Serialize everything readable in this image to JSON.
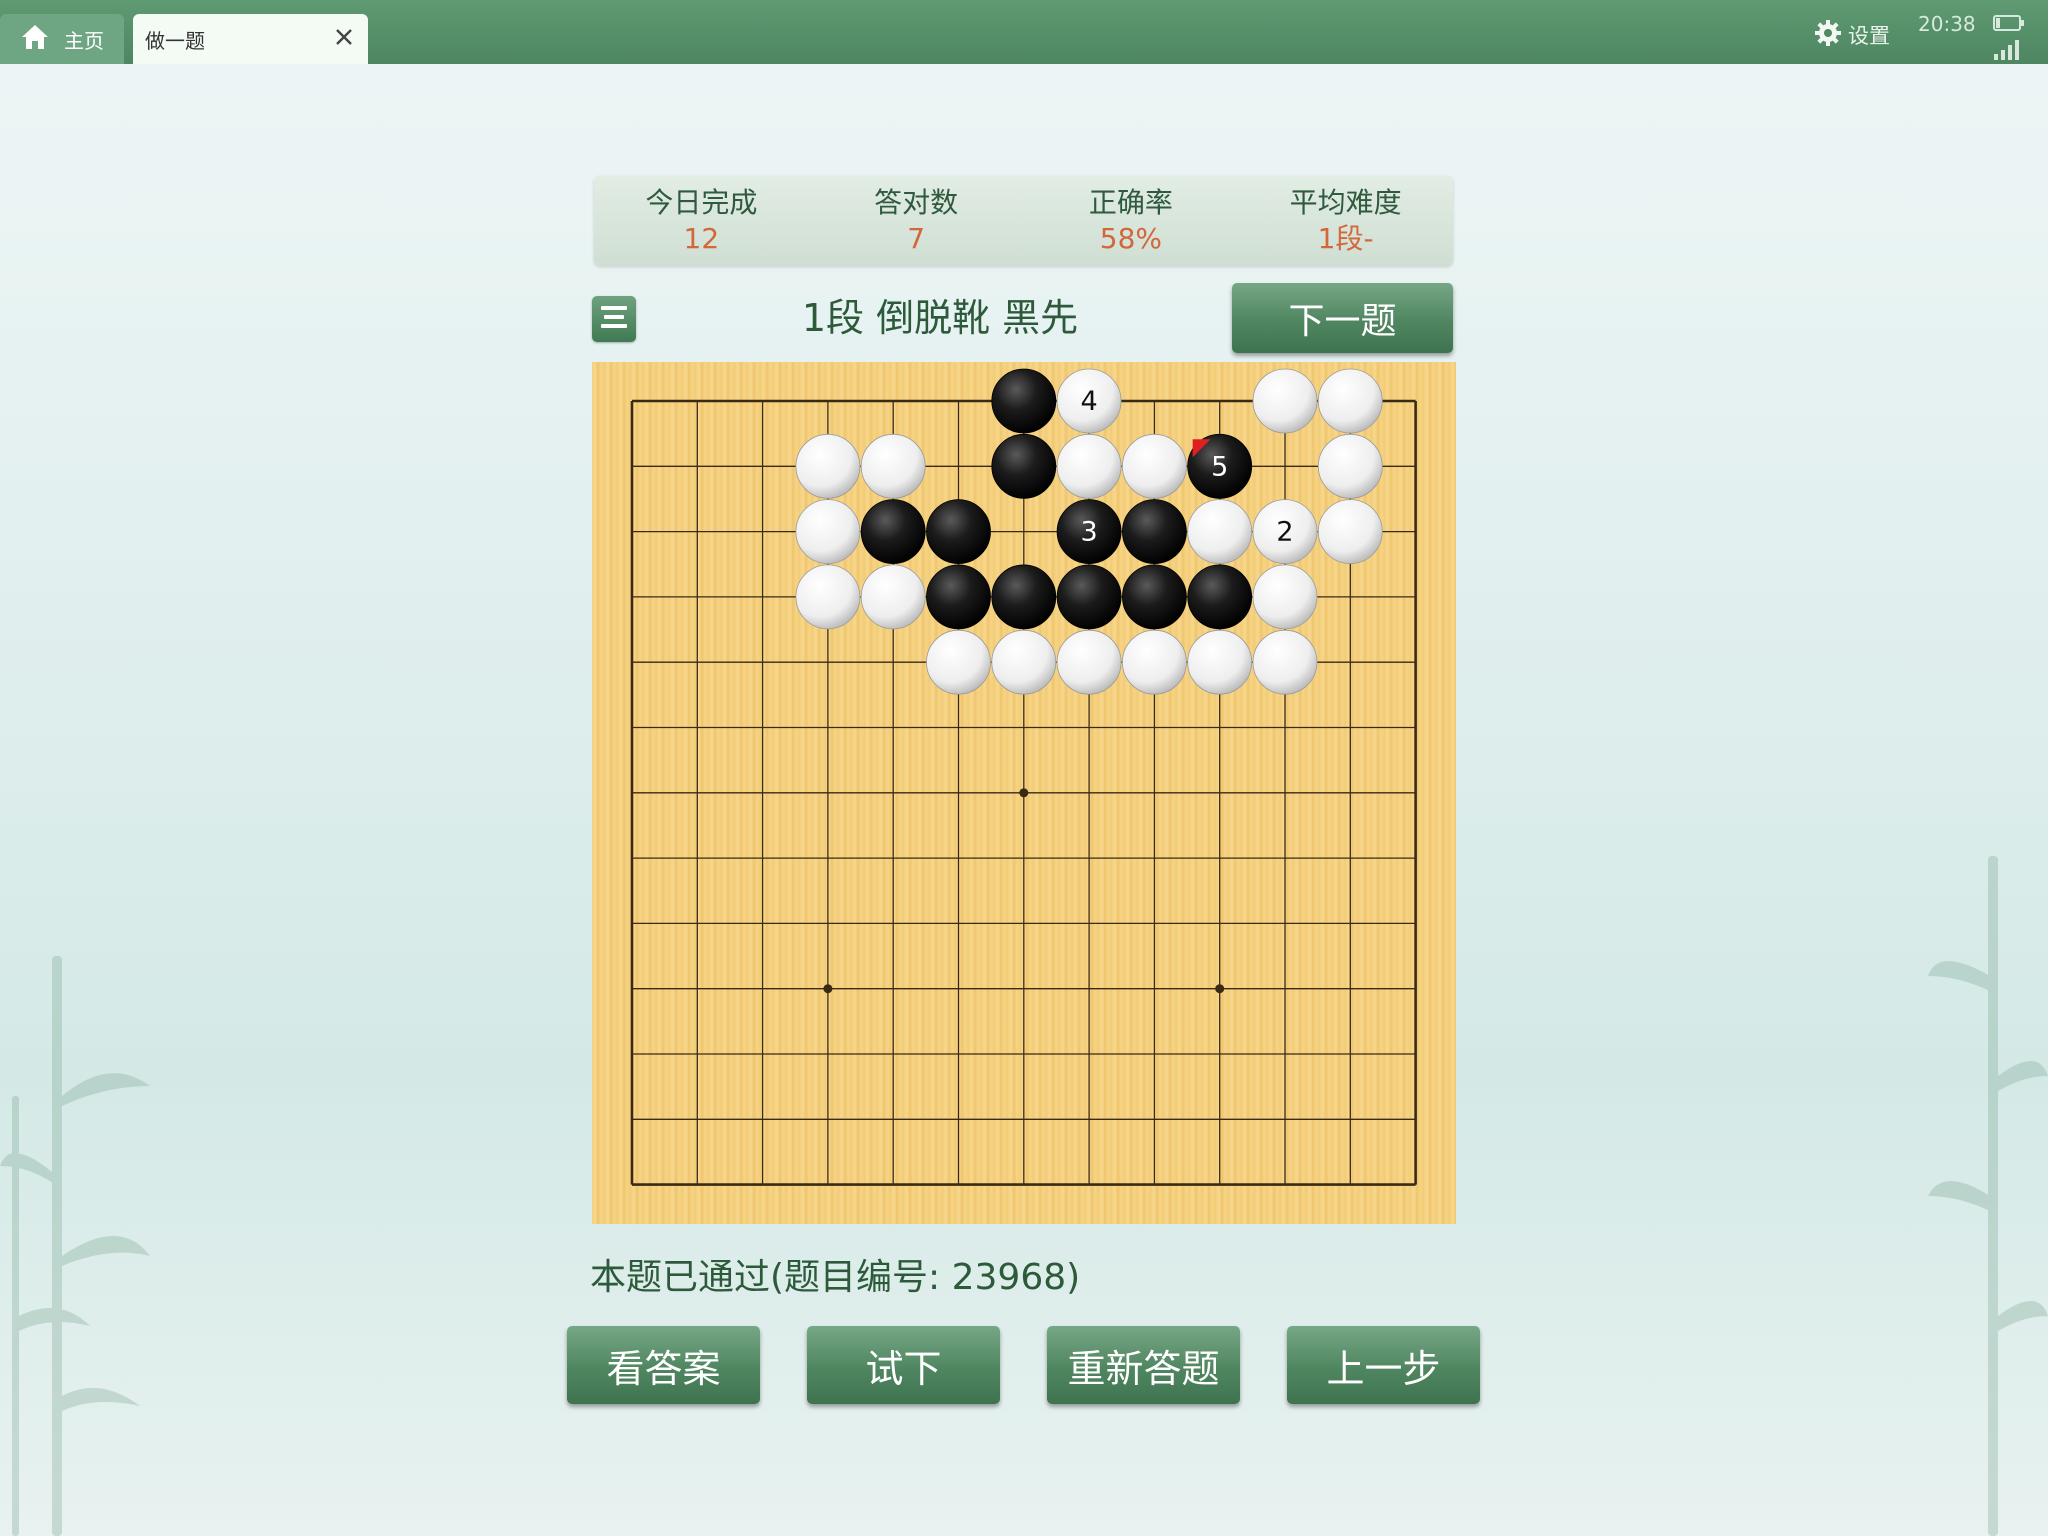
{
  "topbar": {
    "home_tab_label": "主页",
    "active_tab_label": "做一题",
    "settings_label": "设置",
    "time": "20:38"
  },
  "stats": [
    {
      "label": "今日完成",
      "value": "12"
    },
    {
      "label": "答对数",
      "value": "7"
    },
    {
      "label": "正确率",
      "value": "58%"
    },
    {
      "label": "平均难度",
      "value": "1段-"
    }
  ],
  "problem": {
    "title": "1段 倒脱靴 黑先",
    "next_label": "下一题",
    "status": "本题已通过(题目编号: 23968)"
  },
  "board": {
    "size": 13,
    "hoshi": [
      [
        6,
        6
      ],
      [
        3,
        9
      ],
      [
        9,
        9
      ]
    ],
    "stones": [
      {
        "color": "black",
        "x": 6,
        "y": 0
      },
      {
        "color": "white",
        "x": 7,
        "y": 0,
        "label": "4"
      },
      {
        "color": "white",
        "x": 10,
        "y": 0
      },
      {
        "color": "white",
        "x": 11,
        "y": 0
      },
      {
        "color": "white",
        "x": 3,
        "y": 1
      },
      {
        "color": "white",
        "x": 4,
        "y": 1
      },
      {
        "color": "black",
        "x": 6,
        "y": 1
      },
      {
        "color": "white",
        "x": 7,
        "y": 1
      },
      {
        "color": "white",
        "x": 8,
        "y": 1
      },
      {
        "color": "black",
        "x": 9,
        "y": 1,
        "label": "5"
      },
      {
        "color": "white",
        "x": 11,
        "y": 1
      },
      {
        "color": "white",
        "x": 3,
        "y": 2
      },
      {
        "color": "black",
        "x": 4,
        "y": 2
      },
      {
        "color": "black",
        "x": 5,
        "y": 2
      },
      {
        "color": "black",
        "x": 7,
        "y": 2,
        "label": "3"
      },
      {
        "color": "black",
        "x": 8,
        "y": 2
      },
      {
        "color": "white",
        "x": 9,
        "y": 2
      },
      {
        "color": "white",
        "x": 10,
        "y": 2,
        "label": "2"
      },
      {
        "color": "white",
        "x": 11,
        "y": 2
      },
      {
        "color": "white",
        "x": 3,
        "y": 3
      },
      {
        "color": "white",
        "x": 4,
        "y": 3
      },
      {
        "color": "black",
        "x": 5,
        "y": 3
      },
      {
        "color": "black",
        "x": 6,
        "y": 3
      },
      {
        "color": "black",
        "x": 7,
        "y": 3
      },
      {
        "color": "black",
        "x": 8,
        "y": 3
      },
      {
        "color": "black",
        "x": 9,
        "y": 3
      },
      {
        "color": "white",
        "x": 10,
        "y": 3
      },
      {
        "color": "white",
        "x": 5,
        "y": 4
      },
      {
        "color": "white",
        "x": 6,
        "y": 4
      },
      {
        "color": "white",
        "x": 7,
        "y": 4
      },
      {
        "color": "white",
        "x": 8,
        "y": 4
      },
      {
        "color": "white",
        "x": 9,
        "y": 4
      },
      {
        "color": "white",
        "x": 10,
        "y": 4
      }
    ],
    "last_move_marker": {
      "x": 9,
      "y": 1,
      "color": "#e02020"
    }
  },
  "actions": {
    "answer": "看答案",
    "try": "试下",
    "redo": "重新答题",
    "back": "上一步"
  },
  "colors": {
    "accent_green": "#4f8660",
    "value_orange": "#d2673b",
    "title_green": "#2c5a3a"
  }
}
